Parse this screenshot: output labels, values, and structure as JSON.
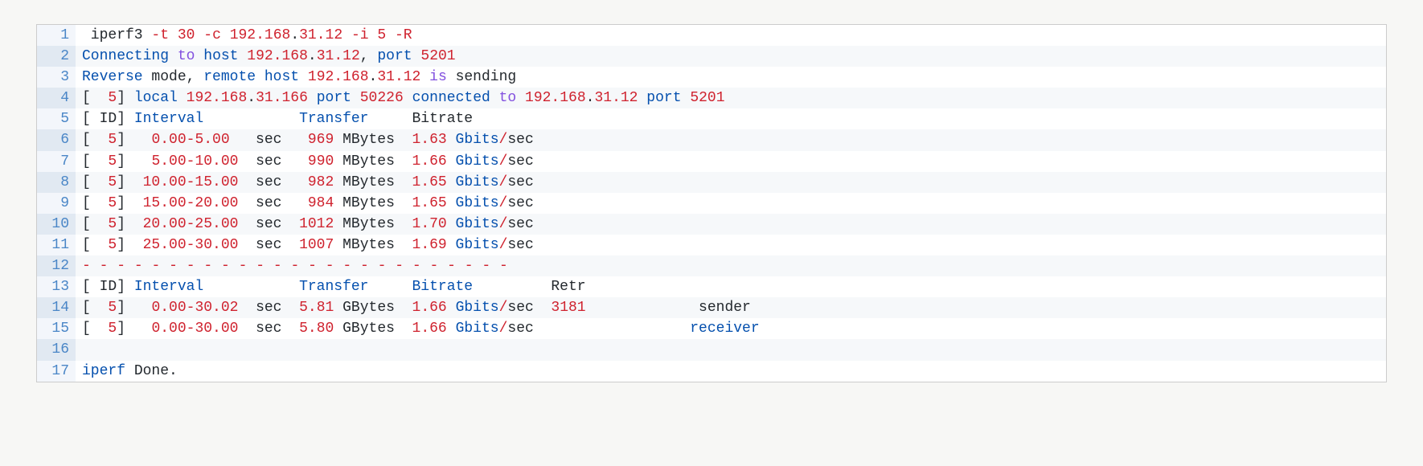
{
  "lines": [
    {
      "n": "1",
      "seg": [
        {
          "c": "plain",
          "t": " iperf3 "
        },
        {
          "c": "red",
          "t": "-t"
        },
        {
          "c": "plain",
          "t": " "
        },
        {
          "c": "red",
          "t": "30"
        },
        {
          "c": "plain",
          "t": " "
        },
        {
          "c": "red",
          "t": "-c"
        },
        {
          "c": "plain",
          "t": " "
        },
        {
          "c": "red",
          "t": "192.168"
        },
        {
          "c": "plain",
          "t": "."
        },
        {
          "c": "red",
          "t": "31.12"
        },
        {
          "c": "plain",
          "t": " "
        },
        {
          "c": "red",
          "t": "-i"
        },
        {
          "c": "plain",
          "t": " "
        },
        {
          "c": "red",
          "t": "5"
        },
        {
          "c": "plain",
          "t": " "
        },
        {
          "c": "red",
          "t": "-R"
        }
      ]
    },
    {
      "n": "2",
      "seg": [
        {
          "c": "blue",
          "t": "Connecting"
        },
        {
          "c": "plain",
          "t": " "
        },
        {
          "c": "kw",
          "t": "to"
        },
        {
          "c": "plain",
          "t": " "
        },
        {
          "c": "blue",
          "t": "host"
        },
        {
          "c": "plain",
          "t": " "
        },
        {
          "c": "red",
          "t": "192.168"
        },
        {
          "c": "plain",
          "t": "."
        },
        {
          "c": "red",
          "t": "31.12"
        },
        {
          "c": "plain",
          "t": ", "
        },
        {
          "c": "blue",
          "t": "port"
        },
        {
          "c": "plain",
          "t": " "
        },
        {
          "c": "red",
          "t": "5201"
        }
      ]
    },
    {
      "n": "3",
      "seg": [
        {
          "c": "blue",
          "t": "Reverse"
        },
        {
          "c": "plain",
          "t": " mode, "
        },
        {
          "c": "blue",
          "t": "remote"
        },
        {
          "c": "plain",
          "t": " "
        },
        {
          "c": "blue",
          "t": "host"
        },
        {
          "c": "plain",
          "t": " "
        },
        {
          "c": "red",
          "t": "192.168"
        },
        {
          "c": "plain",
          "t": "."
        },
        {
          "c": "red",
          "t": "31.12"
        },
        {
          "c": "plain",
          "t": " "
        },
        {
          "c": "kw",
          "t": "is"
        },
        {
          "c": "plain",
          "t": " sending"
        }
      ]
    },
    {
      "n": "4",
      "seg": [
        {
          "c": "plain",
          "t": "[  "
        },
        {
          "c": "red",
          "t": "5"
        },
        {
          "c": "plain",
          "t": "] "
        },
        {
          "c": "blue",
          "t": "local"
        },
        {
          "c": "plain",
          "t": " "
        },
        {
          "c": "red",
          "t": "192.168"
        },
        {
          "c": "plain",
          "t": "."
        },
        {
          "c": "red",
          "t": "31.166"
        },
        {
          "c": "plain",
          "t": " "
        },
        {
          "c": "blue",
          "t": "port"
        },
        {
          "c": "plain",
          "t": " "
        },
        {
          "c": "red",
          "t": "50226"
        },
        {
          "c": "plain",
          "t": " "
        },
        {
          "c": "blue",
          "t": "connected"
        },
        {
          "c": "plain",
          "t": " "
        },
        {
          "c": "kw",
          "t": "to"
        },
        {
          "c": "plain",
          "t": " "
        },
        {
          "c": "red",
          "t": "192.168"
        },
        {
          "c": "plain",
          "t": "."
        },
        {
          "c": "red",
          "t": "31.12"
        },
        {
          "c": "plain",
          "t": " "
        },
        {
          "c": "blue",
          "t": "port"
        },
        {
          "c": "plain",
          "t": " "
        },
        {
          "c": "red",
          "t": "5201"
        }
      ]
    },
    {
      "n": "5",
      "seg": [
        {
          "c": "plain",
          "t": "[ ID] "
        },
        {
          "c": "blue",
          "t": "Interval"
        },
        {
          "c": "plain",
          "t": "           "
        },
        {
          "c": "blue",
          "t": "Transfer"
        },
        {
          "c": "plain",
          "t": "     Bitrate"
        }
      ]
    },
    {
      "n": "6",
      "seg": [
        {
          "c": "plain",
          "t": "[  "
        },
        {
          "c": "red",
          "t": "5"
        },
        {
          "c": "plain",
          "t": "]   "
        },
        {
          "c": "red",
          "t": "0.00-5.00"
        },
        {
          "c": "plain",
          "t": "   sec   "
        },
        {
          "c": "red",
          "t": "969"
        },
        {
          "c": "plain",
          "t": " MBytes  "
        },
        {
          "c": "red",
          "t": "1.63"
        },
        {
          "c": "plain",
          "t": " "
        },
        {
          "c": "blue",
          "t": "Gbits"
        },
        {
          "c": "red",
          "t": "/"
        },
        {
          "c": "plain",
          "t": "sec"
        }
      ]
    },
    {
      "n": "7",
      "seg": [
        {
          "c": "plain",
          "t": "[  "
        },
        {
          "c": "red",
          "t": "5"
        },
        {
          "c": "plain",
          "t": "]   "
        },
        {
          "c": "red",
          "t": "5.00-10.00"
        },
        {
          "c": "plain",
          "t": "  sec   "
        },
        {
          "c": "red",
          "t": "990"
        },
        {
          "c": "plain",
          "t": " MBytes  "
        },
        {
          "c": "red",
          "t": "1.66"
        },
        {
          "c": "plain",
          "t": " "
        },
        {
          "c": "blue",
          "t": "Gbits"
        },
        {
          "c": "red",
          "t": "/"
        },
        {
          "c": "plain",
          "t": "sec"
        }
      ]
    },
    {
      "n": "8",
      "seg": [
        {
          "c": "plain",
          "t": "[  "
        },
        {
          "c": "red",
          "t": "5"
        },
        {
          "c": "plain",
          "t": "]  "
        },
        {
          "c": "red",
          "t": "10.00-15.00"
        },
        {
          "c": "plain",
          "t": "  sec   "
        },
        {
          "c": "red",
          "t": "982"
        },
        {
          "c": "plain",
          "t": " MBytes  "
        },
        {
          "c": "red",
          "t": "1.65"
        },
        {
          "c": "plain",
          "t": " "
        },
        {
          "c": "blue",
          "t": "Gbits"
        },
        {
          "c": "red",
          "t": "/"
        },
        {
          "c": "plain",
          "t": "sec"
        }
      ]
    },
    {
      "n": "9",
      "seg": [
        {
          "c": "plain",
          "t": "[  "
        },
        {
          "c": "red",
          "t": "5"
        },
        {
          "c": "plain",
          "t": "]  "
        },
        {
          "c": "red",
          "t": "15.00-20.00"
        },
        {
          "c": "plain",
          "t": "  sec   "
        },
        {
          "c": "red",
          "t": "984"
        },
        {
          "c": "plain",
          "t": " MBytes  "
        },
        {
          "c": "red",
          "t": "1.65"
        },
        {
          "c": "plain",
          "t": " "
        },
        {
          "c": "blue",
          "t": "Gbits"
        },
        {
          "c": "red",
          "t": "/"
        },
        {
          "c": "plain",
          "t": "sec"
        }
      ]
    },
    {
      "n": "10",
      "seg": [
        {
          "c": "plain",
          "t": "[  "
        },
        {
          "c": "red",
          "t": "5"
        },
        {
          "c": "plain",
          "t": "]  "
        },
        {
          "c": "red",
          "t": "20.00-25.00"
        },
        {
          "c": "plain",
          "t": "  sec  "
        },
        {
          "c": "red",
          "t": "1012"
        },
        {
          "c": "plain",
          "t": " MBytes  "
        },
        {
          "c": "red",
          "t": "1.70"
        },
        {
          "c": "plain",
          "t": " "
        },
        {
          "c": "blue",
          "t": "Gbits"
        },
        {
          "c": "red",
          "t": "/"
        },
        {
          "c": "plain",
          "t": "sec"
        }
      ]
    },
    {
      "n": "11",
      "seg": [
        {
          "c": "plain",
          "t": "[  "
        },
        {
          "c": "red",
          "t": "5"
        },
        {
          "c": "plain",
          "t": "]  "
        },
        {
          "c": "red",
          "t": "25.00-30.00"
        },
        {
          "c": "plain",
          "t": "  sec  "
        },
        {
          "c": "red",
          "t": "1007"
        },
        {
          "c": "plain",
          "t": " MBytes  "
        },
        {
          "c": "red",
          "t": "1.69"
        },
        {
          "c": "plain",
          "t": " "
        },
        {
          "c": "blue",
          "t": "Gbits"
        },
        {
          "c": "red",
          "t": "/"
        },
        {
          "c": "plain",
          "t": "sec"
        }
      ]
    },
    {
      "n": "12",
      "seg": [
        {
          "c": "red",
          "t": "-"
        },
        {
          "c": "plain",
          "t": " "
        },
        {
          "c": "red",
          "t": "-"
        },
        {
          "c": "plain",
          "t": " "
        },
        {
          "c": "red",
          "t": "-"
        },
        {
          "c": "plain",
          "t": " "
        },
        {
          "c": "red",
          "t": "-"
        },
        {
          "c": "plain",
          "t": " "
        },
        {
          "c": "red",
          "t": "-"
        },
        {
          "c": "plain",
          "t": " "
        },
        {
          "c": "red",
          "t": "-"
        },
        {
          "c": "plain",
          "t": " "
        },
        {
          "c": "red",
          "t": "-"
        },
        {
          "c": "plain",
          "t": " "
        },
        {
          "c": "red",
          "t": "-"
        },
        {
          "c": "plain",
          "t": " "
        },
        {
          "c": "red",
          "t": "-"
        },
        {
          "c": "plain",
          "t": " "
        },
        {
          "c": "red",
          "t": "-"
        },
        {
          "c": "plain",
          "t": " "
        },
        {
          "c": "red",
          "t": "-"
        },
        {
          "c": "plain",
          "t": " "
        },
        {
          "c": "red",
          "t": "-"
        },
        {
          "c": "plain",
          "t": " "
        },
        {
          "c": "red",
          "t": "-"
        },
        {
          "c": "plain",
          "t": " "
        },
        {
          "c": "red",
          "t": "-"
        },
        {
          "c": "plain",
          "t": " "
        },
        {
          "c": "red",
          "t": "-"
        },
        {
          "c": "plain",
          "t": " "
        },
        {
          "c": "red",
          "t": "-"
        },
        {
          "c": "plain",
          "t": " "
        },
        {
          "c": "red",
          "t": "-"
        },
        {
          "c": "plain",
          "t": " "
        },
        {
          "c": "red",
          "t": "-"
        },
        {
          "c": "plain",
          "t": " "
        },
        {
          "c": "red",
          "t": "-"
        },
        {
          "c": "plain",
          "t": " "
        },
        {
          "c": "red",
          "t": "-"
        },
        {
          "c": "plain",
          "t": " "
        },
        {
          "c": "red",
          "t": "-"
        },
        {
          "c": "plain",
          "t": " "
        },
        {
          "c": "red",
          "t": "-"
        },
        {
          "c": "plain",
          "t": " "
        },
        {
          "c": "red",
          "t": "-"
        },
        {
          "c": "plain",
          "t": " "
        },
        {
          "c": "red",
          "t": "-"
        },
        {
          "c": "plain",
          "t": " "
        },
        {
          "c": "red",
          "t": "-"
        }
      ]
    },
    {
      "n": "13",
      "seg": [
        {
          "c": "plain",
          "t": "[ ID] "
        },
        {
          "c": "blue",
          "t": "Interval"
        },
        {
          "c": "plain",
          "t": "           "
        },
        {
          "c": "blue",
          "t": "Transfer"
        },
        {
          "c": "plain",
          "t": "     "
        },
        {
          "c": "blue",
          "t": "Bitrate"
        },
        {
          "c": "plain",
          "t": "         Retr"
        }
      ]
    },
    {
      "n": "14",
      "seg": [
        {
          "c": "plain",
          "t": "[  "
        },
        {
          "c": "red",
          "t": "5"
        },
        {
          "c": "plain",
          "t": "]   "
        },
        {
          "c": "red",
          "t": "0.00-30.02"
        },
        {
          "c": "plain",
          "t": "  sec  "
        },
        {
          "c": "red",
          "t": "5.81"
        },
        {
          "c": "plain",
          "t": " GBytes  "
        },
        {
          "c": "red",
          "t": "1.66"
        },
        {
          "c": "plain",
          "t": " "
        },
        {
          "c": "blue",
          "t": "Gbits"
        },
        {
          "c": "red",
          "t": "/"
        },
        {
          "c": "plain",
          "t": "sec  "
        },
        {
          "c": "red",
          "t": "3181"
        },
        {
          "c": "plain",
          "t": "             sender"
        }
      ]
    },
    {
      "n": "15",
      "seg": [
        {
          "c": "plain",
          "t": "[  "
        },
        {
          "c": "red",
          "t": "5"
        },
        {
          "c": "plain",
          "t": "]   "
        },
        {
          "c": "red",
          "t": "0.00-30.00"
        },
        {
          "c": "plain",
          "t": "  sec  "
        },
        {
          "c": "red",
          "t": "5.80"
        },
        {
          "c": "plain",
          "t": " GBytes  "
        },
        {
          "c": "red",
          "t": "1.66"
        },
        {
          "c": "plain",
          "t": " "
        },
        {
          "c": "blue",
          "t": "Gbits"
        },
        {
          "c": "red",
          "t": "/"
        },
        {
          "c": "plain",
          "t": "sec                  "
        },
        {
          "c": "blue",
          "t": "receiver"
        }
      ]
    },
    {
      "n": "16",
      "seg": [
        {
          "c": "plain",
          "t": ""
        }
      ]
    },
    {
      "n": "17",
      "seg": [
        {
          "c": "blue",
          "t": "iperf"
        },
        {
          "c": "plain",
          "t": " Done."
        }
      ]
    }
  ]
}
